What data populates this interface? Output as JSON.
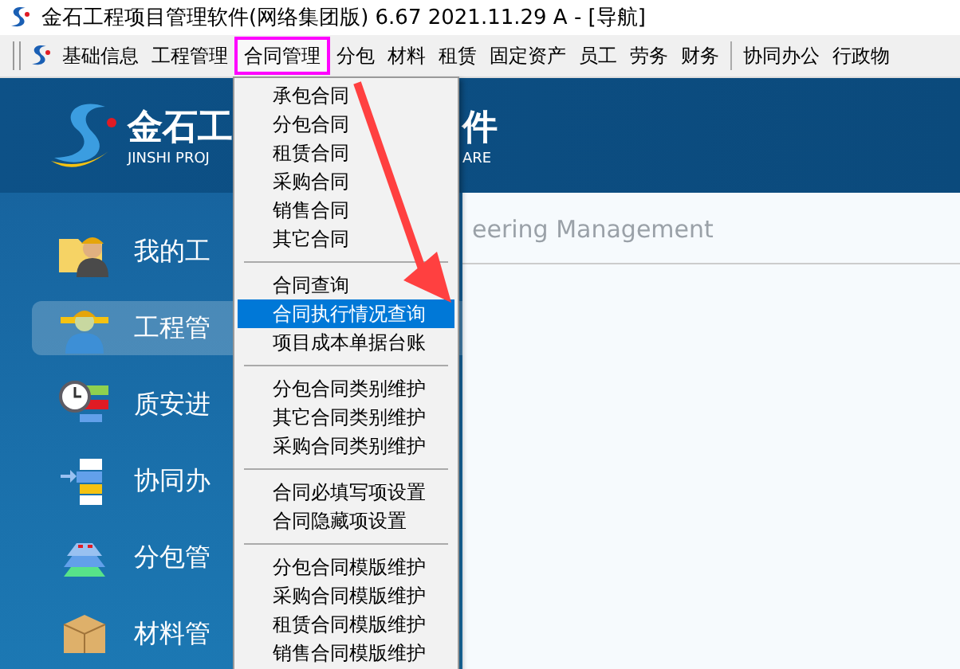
{
  "window": {
    "title": "金石工程项目管理软件(网络集团版) 6.67   2021.11.29 A - [导航]"
  },
  "menu_bar": [
    {
      "label": "基础信息",
      "selected": false
    },
    {
      "label": "工程管理",
      "selected": false
    },
    {
      "label": "合同管理",
      "selected": true
    },
    {
      "label": "分包",
      "selected": false
    },
    {
      "label": "材料",
      "selected": false
    },
    {
      "label": "租赁",
      "selected": false
    },
    {
      "label": "固定资产",
      "selected": false
    },
    {
      "label": "员工",
      "selected": false
    },
    {
      "label": "劳务",
      "selected": false
    },
    {
      "label": "财务",
      "selected": false,
      "separator_after": true
    },
    {
      "label": "协同办公",
      "selected": false
    },
    {
      "label": "行政物",
      "selected": false
    }
  ],
  "banner": {
    "title": "金石工",
    "title_tail": "件",
    "subtitle": "JINSHI PROJ",
    "subtitle_tail": "ARE"
  },
  "content": {
    "heading": "eering Management"
  },
  "sidebar": [
    {
      "label": "我的工",
      "kind": "worker",
      "selected": false
    },
    {
      "label": "工程管",
      "kind": "engineer",
      "selected": true
    },
    {
      "label": "质安进",
      "kind": "clock",
      "selected": false
    },
    {
      "label": "协同办",
      "kind": "blocks",
      "selected": false
    },
    {
      "label": "分包管",
      "kind": "layers",
      "selected": false
    },
    {
      "label": "材料管",
      "kind": "box",
      "selected": false
    }
  ],
  "dropdown": [
    [
      {
        "label": "承包合同",
        "selected": false
      },
      {
        "label": "分包合同",
        "selected": false
      },
      {
        "label": "租赁合同",
        "selected": false
      },
      {
        "label": "采购合同",
        "selected": false
      },
      {
        "label": "销售合同",
        "selected": false
      },
      {
        "label": "其它合同",
        "selected": false
      }
    ],
    [
      {
        "label": "合同查询",
        "selected": false
      },
      {
        "label": "合同执行情况查询",
        "selected": true
      },
      {
        "label": "项目成本单据台账",
        "selected": false
      }
    ],
    [
      {
        "label": "分包合同类别维护",
        "selected": false
      },
      {
        "label": "其它合同类别维护",
        "selected": false
      },
      {
        "label": "采购合同类别维护",
        "selected": false
      }
    ],
    [
      {
        "label": "合同必填写项设置",
        "selected": false
      },
      {
        "label": "合同隐藏项设置",
        "selected": false
      }
    ],
    [
      {
        "label": "分包合同模版维护",
        "selected": false
      },
      {
        "label": "采购合同模版维护",
        "selected": false
      },
      {
        "label": "租赁合同模版维护",
        "selected": false
      },
      {
        "label": "销售合同模版维护",
        "selected": false
      }
    ]
  ]
}
